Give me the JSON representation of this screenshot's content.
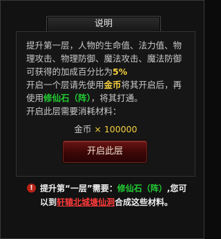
{
  "dialog": {
    "title": "说明"
  },
  "description": {
    "para1_prefix": "提升第一层，人物的生命值、法力值、物理攻击、物理防御、魔法攻击、魔法防御可获得的加成百分比为",
    "para1_percent": "5%",
    "para2_a": "开启一个层请先使用",
    "para2_gold": "金币",
    "para2_b": "将其开启后，再使用",
    "para2_stone": "修仙石（阵）",
    "para2_c": "，将其打通。",
    "para3": "开启此层需要消耗材料："
  },
  "cost": {
    "label": "金币",
    "amount": "× 100000"
  },
  "buttons": {
    "open_layer": "开启此层"
  },
  "notice": {
    "icon_glyph": "!",
    "part1": "提升第“一层”需要：",
    "item": "修仙石（阵）",
    "part2": ",您可",
    "part3": "以到",
    "link": "轩辕北城塘仙洞",
    "part4": "合成这些材料。"
  },
  "colors": {
    "accent": "#f5d040",
    "green": "#22cc33",
    "link_red": "#ff3a3a",
    "button_red": "#4a0b09"
  }
}
